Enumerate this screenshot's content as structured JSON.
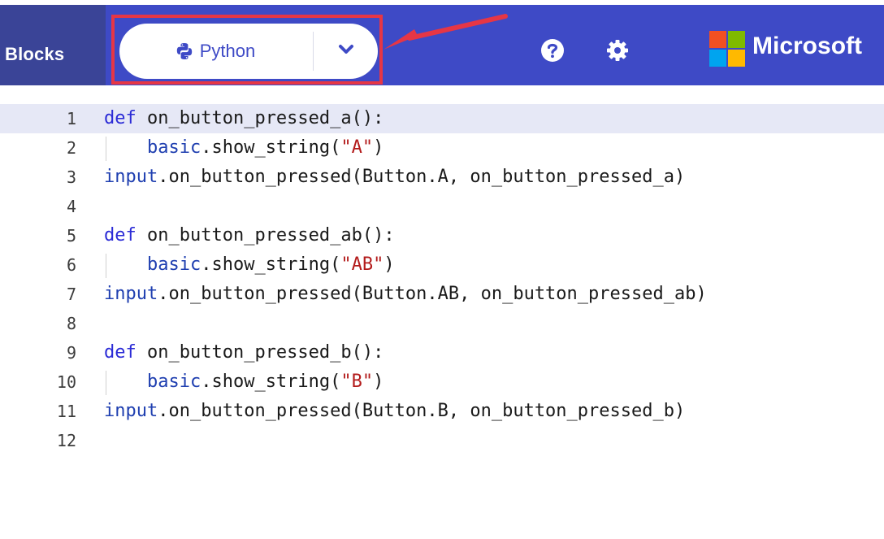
{
  "header": {
    "blocks_tab_label": "Blocks",
    "python_tab_label": "Python",
    "dropdown_icon": "chevron-down-icon",
    "help_icon": "question-circle-icon",
    "settings_icon": "gear-icon",
    "brand_label": "Microsoft",
    "colors": {
      "band": "#3e4ac6",
      "blocks_tab_bg": "#3a4497",
      "highlight": "#e63645"
    }
  },
  "editor": {
    "lines": [
      {
        "num": "1",
        "kw": "def",
        "text": " on_button_pressed_a():"
      },
      {
        "num": "2",
        "indent": "    ",
        "mod": "basic",
        "text": ".show_string(",
        "str": "\"A\"",
        "tail": ")"
      },
      {
        "num": "3",
        "mod": "input",
        "text": ".on_button_pressed(Button.A, on_button_pressed_a)"
      },
      {
        "num": "4",
        "text": ""
      },
      {
        "num": "5",
        "kw": "def",
        "text": " on_button_pressed_ab():"
      },
      {
        "num": "6",
        "indent": "    ",
        "mod": "basic",
        "text": ".show_string(",
        "str": "\"AB\"",
        "tail": ")"
      },
      {
        "num": "7",
        "mod": "input",
        "text": ".on_button_pressed(Button.AB, on_button_pressed_ab)"
      },
      {
        "num": "8",
        "text": ""
      },
      {
        "num": "9",
        "kw": "def",
        "text": " on_button_pressed_b():"
      },
      {
        "num": "10",
        "indent": "    ",
        "mod": "basic",
        "text": ".show_string(",
        "str": "\"B\"",
        "tail": ")"
      },
      {
        "num": "11",
        "mod": "input",
        "text": ".on_button_pressed(Button.B, on_button_pressed_b)"
      },
      {
        "num": "12",
        "text": ""
      }
    ]
  }
}
